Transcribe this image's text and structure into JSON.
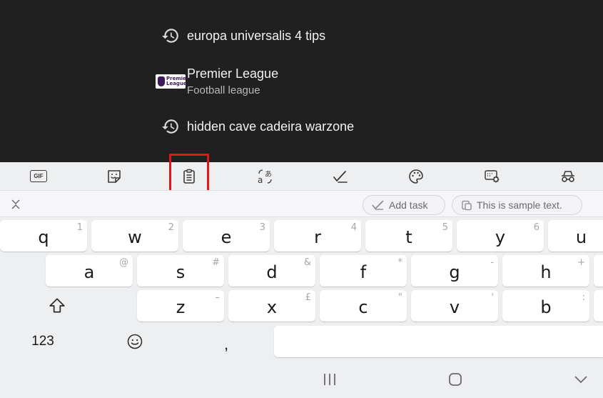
{
  "suggestions": [
    {
      "type": "history",
      "icon": "history-icon",
      "text": "europa universalis 4 tips"
    },
    {
      "type": "entity",
      "icon": "premier-league-logo",
      "logo_text": "Premier League",
      "text": "Premier League",
      "subtext": "Football league"
    },
    {
      "type": "history",
      "icon": "history-icon",
      "text": "hidden cave cadeira warzone"
    }
  ],
  "toolbar": {
    "gif_label": "GIF",
    "items": [
      "gif",
      "stickers",
      "clipboard",
      "translate",
      "spell-check",
      "themes",
      "settings",
      "incognito"
    ],
    "selected": "clipboard"
  },
  "clipboard": {
    "close_icon": "close-icon",
    "chips": [
      {
        "icon": "add-task-icon",
        "label": "Add task"
      },
      {
        "icon": "paste-icon",
        "label": "This is sample text."
      }
    ]
  },
  "keyboard": {
    "row1": [
      {
        "key": "q",
        "hint": "1"
      },
      {
        "key": "w",
        "hint": "2"
      },
      {
        "key": "e",
        "hint": "3"
      },
      {
        "key": "r",
        "hint": "4"
      },
      {
        "key": "t",
        "hint": "5"
      },
      {
        "key": "y",
        "hint": "6"
      },
      {
        "key": "u",
        "hint": ""
      }
    ],
    "row2": [
      {
        "key": "a",
        "hint": "@"
      },
      {
        "key": "s",
        "hint": "#"
      },
      {
        "key": "d",
        "hint": "&"
      },
      {
        "key": "f",
        "hint": "*"
      },
      {
        "key": "g",
        "hint": "-"
      },
      {
        "key": "h",
        "hint": "+"
      },
      {
        "key": "",
        "hint": ""
      }
    ],
    "row3": [
      {
        "key": "z",
        "hint": "–"
      },
      {
        "key": "x",
        "hint": "£"
      },
      {
        "key": "c",
        "hint": "\""
      },
      {
        "key": "v",
        "hint": "'"
      },
      {
        "key": "b",
        "hint": ":"
      },
      {
        "key": "",
        "hint": ""
      }
    ],
    "numbers_label": "123",
    "comma_label": ",",
    "shift_icon": "shift-icon",
    "emoji_icon": "emoji-icon"
  },
  "navbar": {
    "items": [
      "recent-apps-icon",
      "home-icon",
      "hide-keyboard-icon"
    ]
  },
  "colors": {
    "suggestions_bg": "#202020",
    "highlight": "#e3161b",
    "keyboard_bg": "#eeeff1"
  }
}
